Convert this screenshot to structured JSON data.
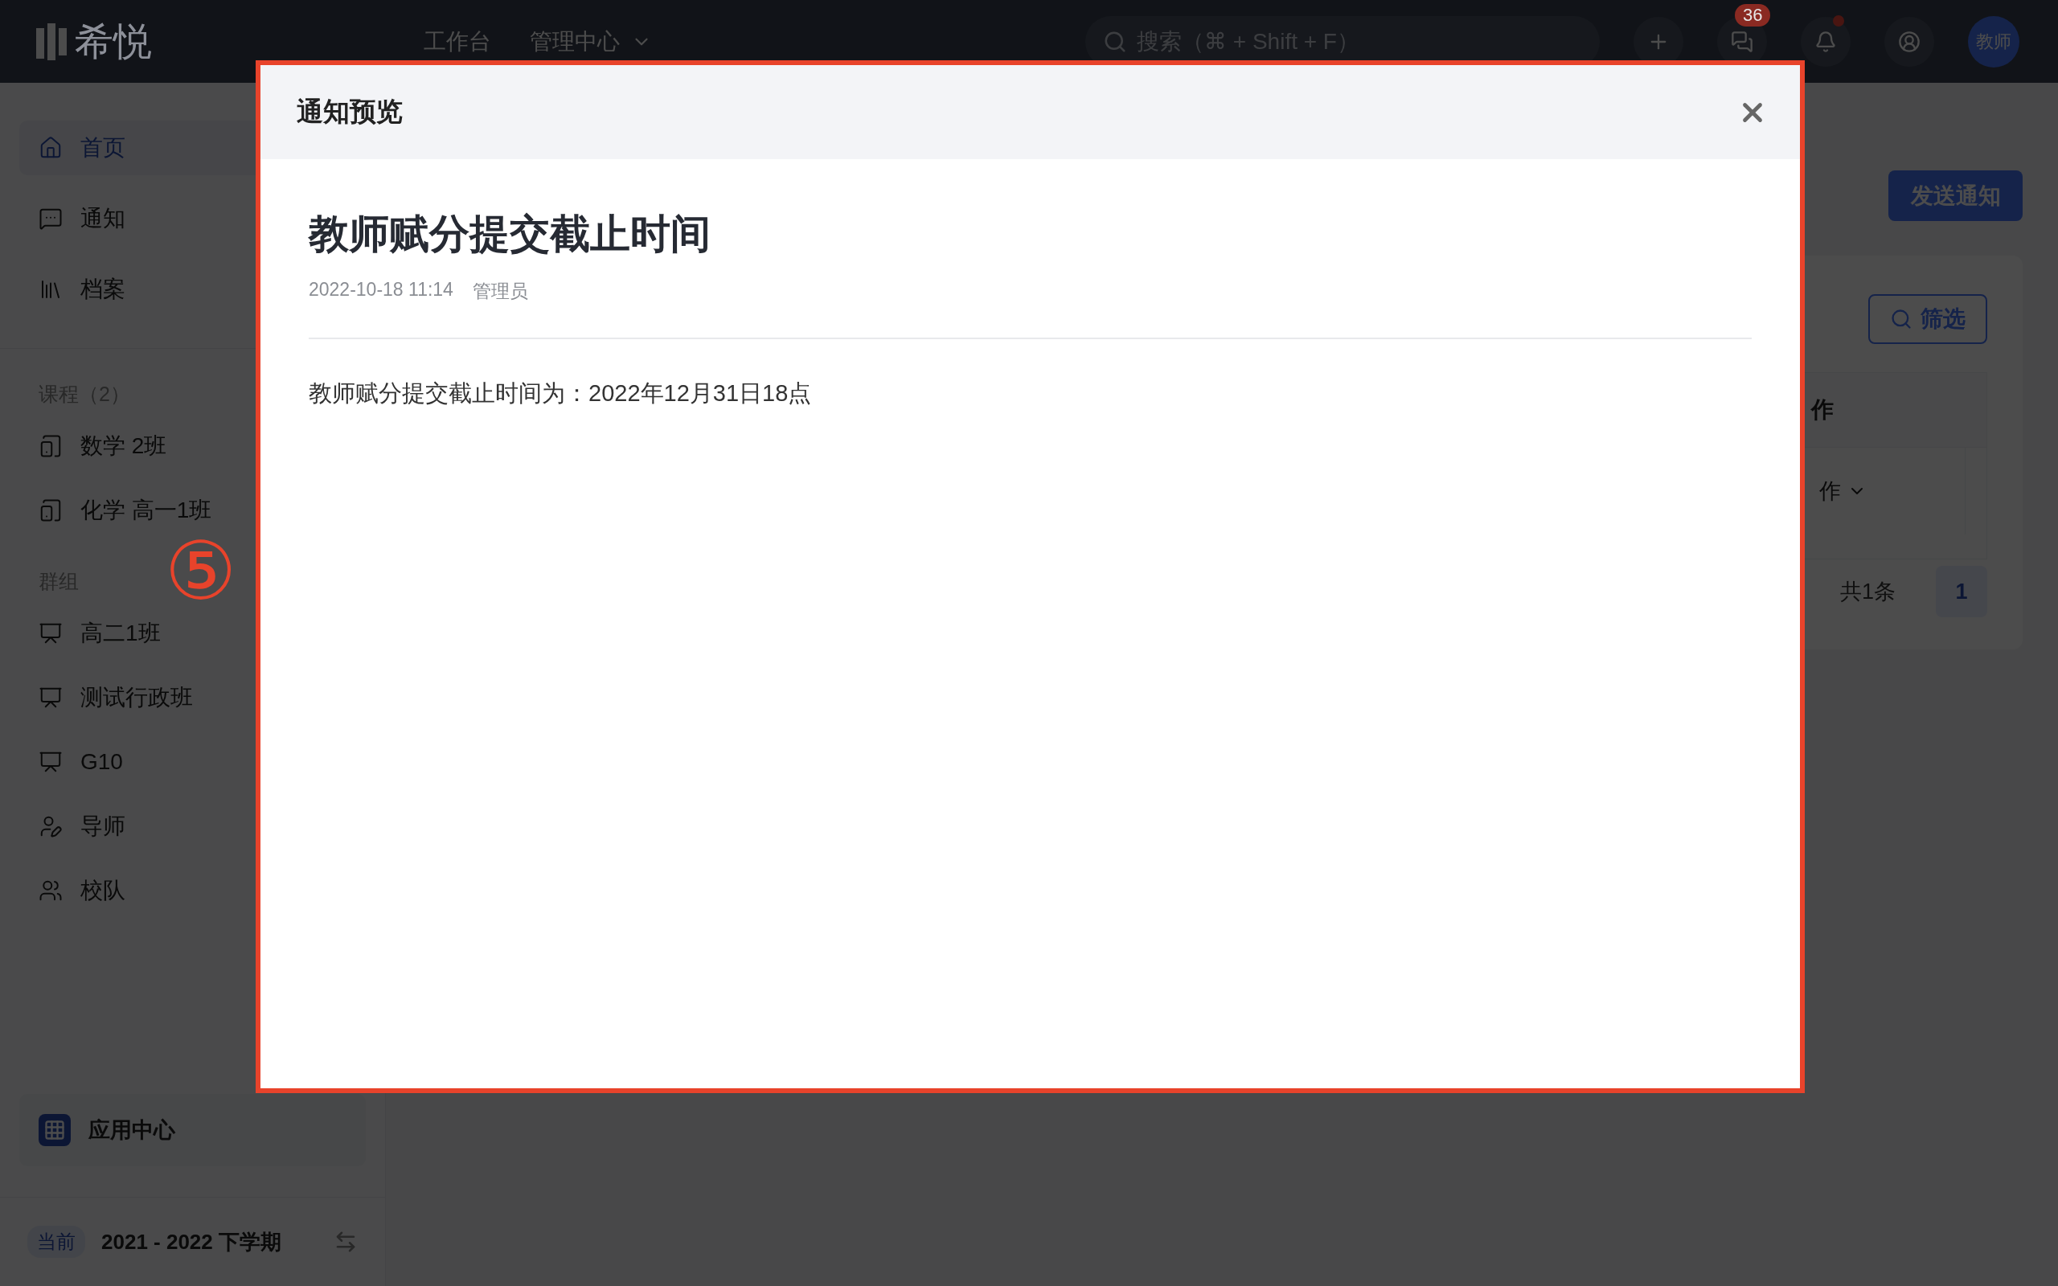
{
  "top_bar": {
    "logo": "希悦",
    "nav": [
      {
        "label": "工作台",
        "has_menu": false
      },
      {
        "label": "管理中心",
        "has_menu": true
      }
    ],
    "search": {
      "placeholder": "搜索（⌘ + Shift + F）"
    },
    "messages_badge": "36",
    "notifications_unread": true,
    "avatar": "教师"
  },
  "sidebar": {
    "main_items": [
      {
        "label": "首页",
        "selected": true
      },
      {
        "label": "通知",
        "selected": false
      },
      {
        "label": "档案",
        "selected": false
      }
    ],
    "courses": {
      "heading": "课程（2）",
      "items": [
        {
          "label": "数学 2班",
          "selected": false
        },
        {
          "label": "化学 高一1班",
          "selected": false
        }
      ]
    },
    "groups": {
      "heading": "群组",
      "items": [
        {
          "label": "高二1班",
          "selected": false
        },
        {
          "label": "测试行政班",
          "selected": false
        },
        {
          "label": "G10",
          "selected": false
        },
        {
          "label": "导师",
          "selected": false
        },
        {
          "label": "校队",
          "selected": false
        }
      ]
    },
    "app_center": "应用中心",
    "term": {
      "badge": "当前",
      "label": "2021 - 2022 下学期"
    }
  },
  "main": {
    "send_button": "发送通知",
    "filter_button": "筛选",
    "table": {
      "header": "作",
      "cell": "作"
    },
    "pagination": {
      "total": "共1条",
      "pages": [
        {
          "label": "1",
          "selected": true
        }
      ]
    }
  },
  "modal": {
    "title": "通知预览",
    "notice_title": "教师赋分提交截止时间",
    "date": "2022-10-18 11:14",
    "author": "管理员",
    "body": "教师赋分提交截止时间为：2022年12月31日18点"
  },
  "annotation": "⑤"
}
